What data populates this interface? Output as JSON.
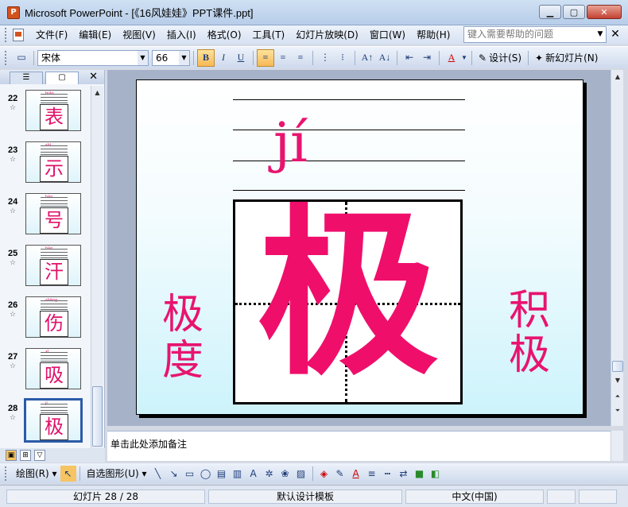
{
  "window": {
    "title": "Microsoft PowerPoint - [《16风娃娃》PPT课件.ppt]",
    "app_icon": "powerpoint-icon",
    "buttons": [
      "minimize",
      "maximize",
      "close"
    ]
  },
  "menu": {
    "items": [
      "文件(F)",
      "编辑(E)",
      "视图(V)",
      "插入(I)",
      "格式(O)",
      "工具(T)",
      "幻灯片放映(D)",
      "窗口(W)",
      "帮助(H)"
    ],
    "help_placeholder": "键入需要帮助的问题"
  },
  "toolbar": {
    "font": "宋体",
    "size": "66",
    "bold": "B",
    "italic": "I",
    "underline": "U",
    "design_label": "设计(S)",
    "new_slide_label": "新幻灯片(N)"
  },
  "slides": [
    {
      "num": "22",
      "char": "表",
      "pinyin": "biǎo"
    },
    {
      "num": "23",
      "char": "示",
      "pinyin": "shì"
    },
    {
      "num": "24",
      "char": "号",
      "pinyin": "hào"
    },
    {
      "num": "25",
      "char": "汗",
      "pinyin": "hàn"
    },
    {
      "num": "26",
      "char": "伤",
      "pinyin": "shāng"
    },
    {
      "num": "27",
      "char": "吸",
      "pinyin": "xī"
    },
    {
      "num": "28",
      "char": "极",
      "pinyin": "jí",
      "selected": true
    }
  ],
  "slide": {
    "pinyin": "jí",
    "character": "极",
    "word_left": "极度",
    "word_right": "积极"
  },
  "notes": {
    "placeholder": "单击此处添加备注"
  },
  "drawing": {
    "draw_label": "绘图(R)",
    "autoshapes_label": "自选图形(U)"
  },
  "status": {
    "slide_indicator": "幻灯片 28 / 28",
    "design": "默认设计模板",
    "language": "中文(中国)"
  },
  "colors": {
    "accent_pink": "#e8146f",
    "title_bar": "#b7cde9",
    "selection": "#2b5ba8"
  }
}
